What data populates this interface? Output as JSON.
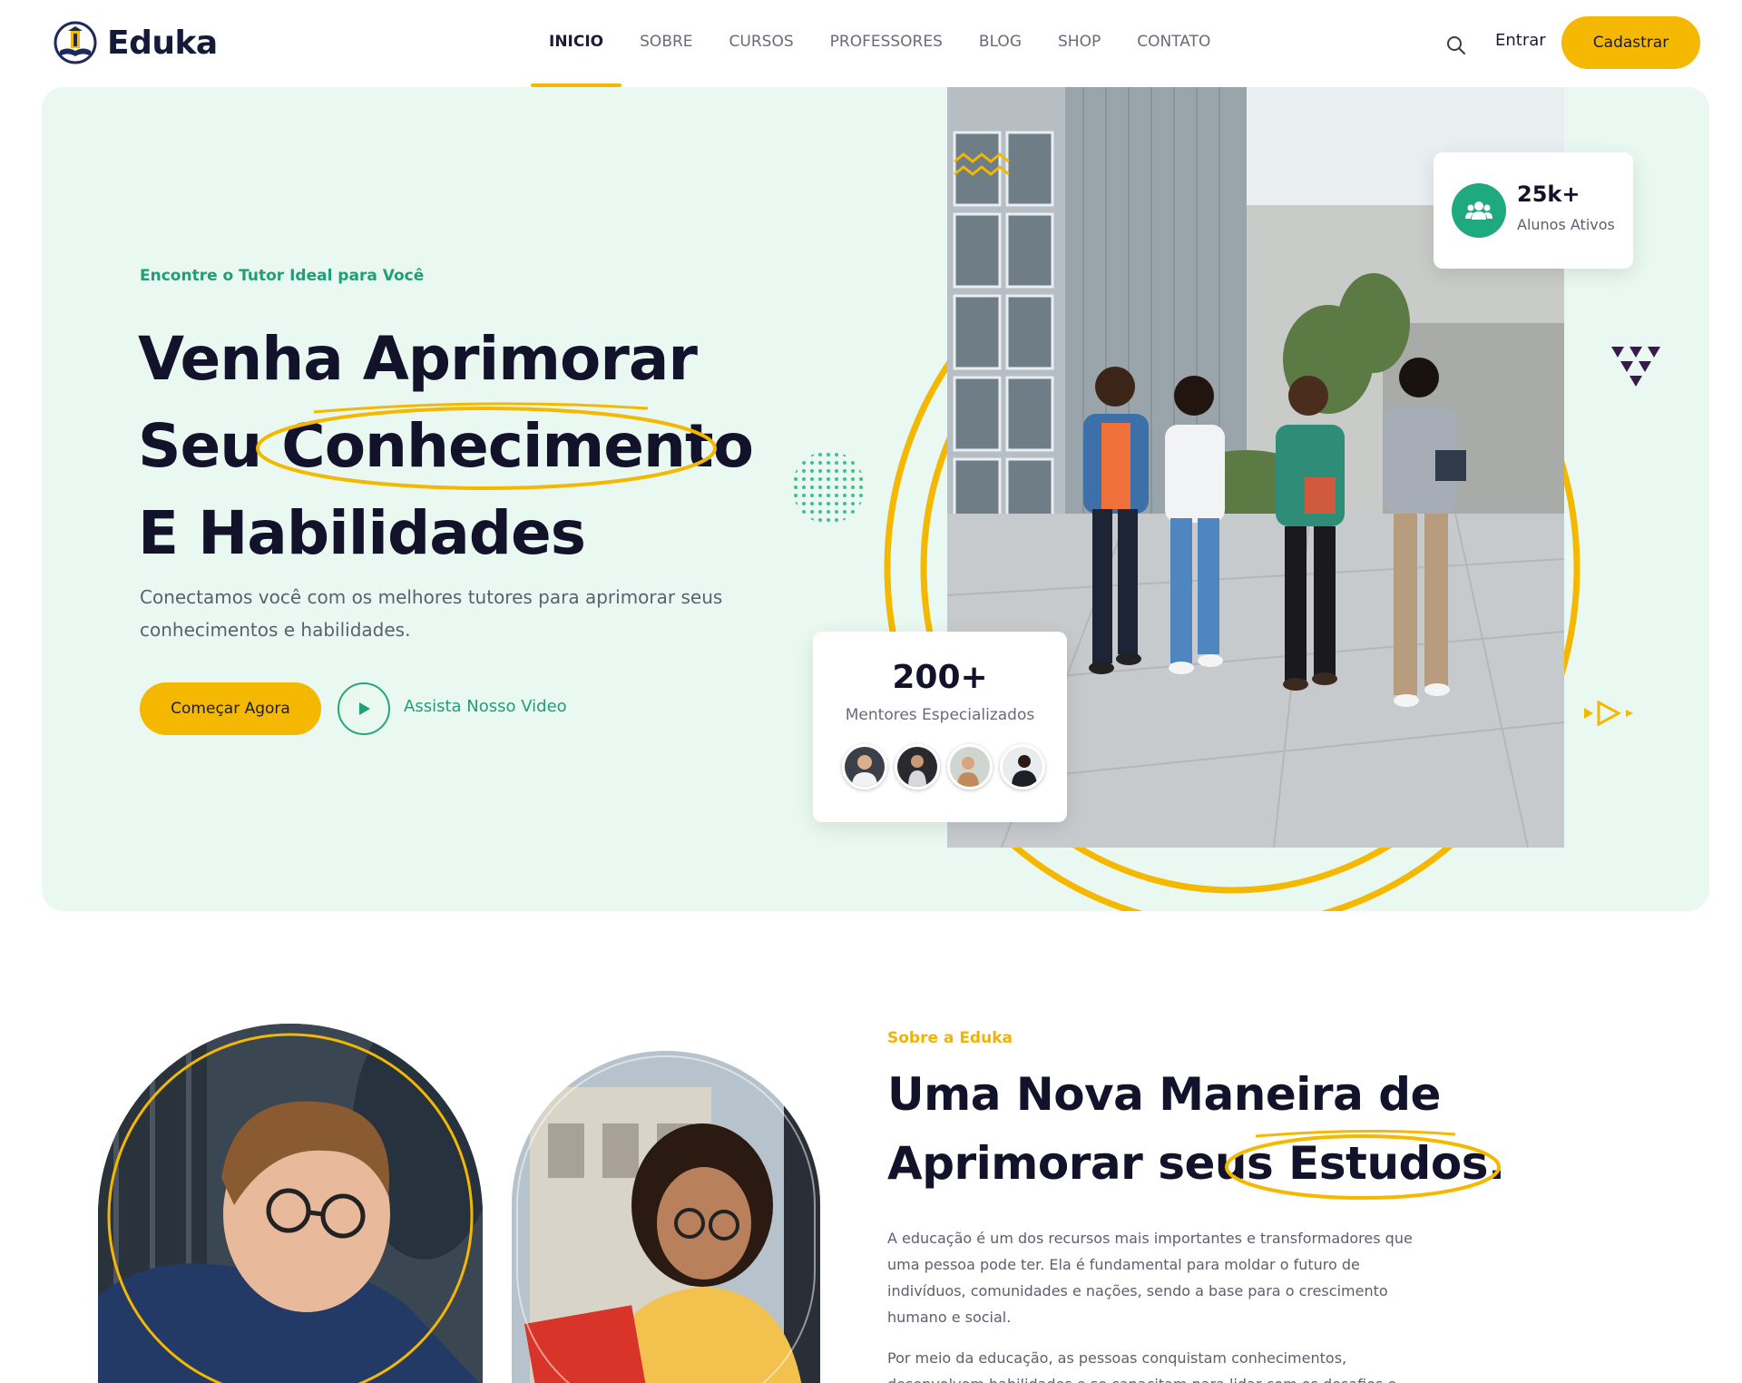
{
  "brand": {
    "name": "Eduka",
    "accent": "#f5b800",
    "green": "#1f9e78",
    "hero_bg": "#eaf8f2"
  },
  "nav": {
    "items": [
      {
        "label": "INICIO",
        "active": true
      },
      {
        "label": "SOBRE"
      },
      {
        "label": "CURSOS"
      },
      {
        "label": "PROFESSORES"
      },
      {
        "label": "BLOG"
      },
      {
        "label": "SHOP"
      },
      {
        "label": "CONTATO"
      }
    ],
    "login_label": "Entrar",
    "signup_label": "Cadastrar",
    "search_icon": "search-icon"
  },
  "hero": {
    "eyebrow": "Encontre o Tutor Ideal para Você",
    "title_line1": "Venha Aprimorar",
    "title_line2_prefix": "Seu ",
    "title_line2_highlight": "Conhecimento",
    "title_line3": "E Habilidades",
    "description": "Conectamos você com os melhores tutores para aprimorar seus conhecimentos e habilidades.",
    "cta_label": "Começar Agora",
    "video_label": "Assista Nosso Video",
    "stat_students_value": "25k+",
    "stat_students_label": "Alunos Ativos",
    "stat_mentors_value": "200+",
    "stat_mentors_label": "Mentores Especializados"
  },
  "about": {
    "eyebrow": "Sobre a Eduka",
    "title_line1": "Uma Nova Maneira de",
    "title_line2_prefix": "Aprimorar seus ",
    "title_line2_highlight": "Estudos.",
    "paragraph1": "A educação é um dos recursos mais importantes e transformadores que uma pessoa pode ter. Ela é fundamental para moldar o futuro de indivíduos, comunidades e nações, sendo a base para o crescimento humano e social.",
    "paragraph2": "Por meio da educação, as pessoas conquistam conhecimentos, desenvolvem habilidades e se capacitam para lidar com os desafios e"
  }
}
